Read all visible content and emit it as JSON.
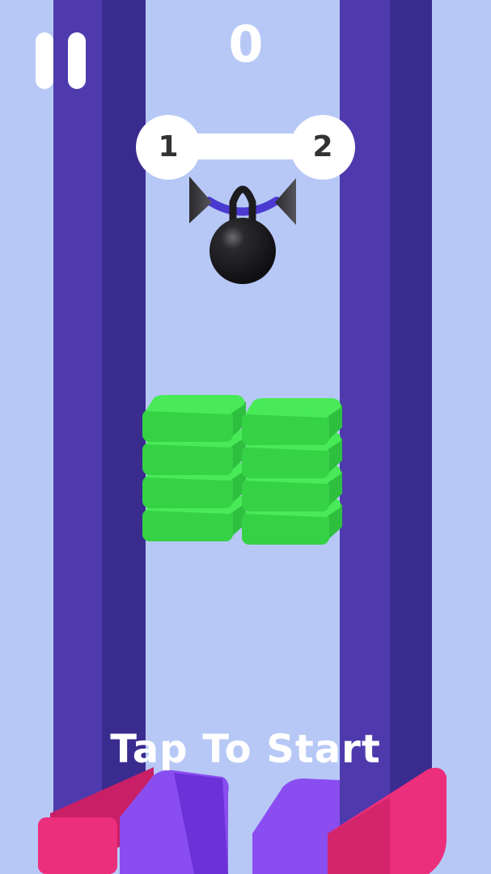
{
  "hud": {
    "score": "0",
    "level_current": "1",
    "level_next": "2",
    "pause_icon": "pause-icon"
  },
  "prompt": {
    "tap_to_start": "Tap To Start"
  },
  "scene": {
    "green_stack_left_count": 4,
    "green_stack_right_count": 4,
    "colors": {
      "background": "#b7c8f6",
      "pillar": "#4e3aad",
      "platform_green": "#3de04c",
      "base_pink": "#ec2f7c",
      "base_purple": "#8a4df0",
      "ball": "#1c1c1f"
    }
  }
}
